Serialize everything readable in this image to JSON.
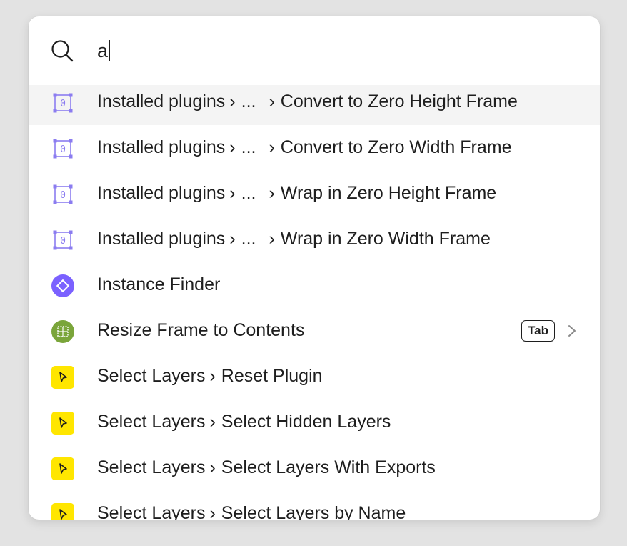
{
  "search": {
    "query": "a"
  },
  "results": [
    {
      "icon": "zero-frame-icon",
      "path": "Installed plugins",
      "ellipsis": "...",
      "command": "Convert to Zero Height Frame",
      "selected": true
    },
    {
      "icon": "zero-frame-icon",
      "path": "Installed plugins",
      "ellipsis": "...",
      "command": "Convert to Zero Width Frame"
    },
    {
      "icon": "zero-frame-icon",
      "path": "Installed plugins",
      "ellipsis": "...",
      "command": "Wrap in Zero Height Frame"
    },
    {
      "icon": "zero-frame-icon",
      "path": "Installed plugins",
      "ellipsis": "...",
      "command": "Wrap in Zero Width Frame"
    },
    {
      "icon": "instance-finder-icon",
      "command": "Instance Finder"
    },
    {
      "icon": "resize-frame-icon",
      "command": "Resize Frame to Contents",
      "shortcut": "Tab"
    },
    {
      "icon": "select-layers-icon",
      "path": "Select Layers",
      "command": "Reset Plugin"
    },
    {
      "icon": "select-layers-icon",
      "path": "Select Layers",
      "command": "Select Hidden Layers"
    },
    {
      "icon": "select-layers-icon",
      "path": "Select Layers",
      "command": "Select Layers With Exports"
    },
    {
      "icon": "select-layers-icon",
      "path": "Select Layers",
      "command": "Select Layers by Name"
    }
  ],
  "colors": {
    "accent_purple": "#7b61ff",
    "zero_frame_purple": "#8b7cf0",
    "resize_green": "#7aa53a",
    "select_yellow": "#ffe600",
    "selected_row_bg": "#f4f4f4"
  }
}
